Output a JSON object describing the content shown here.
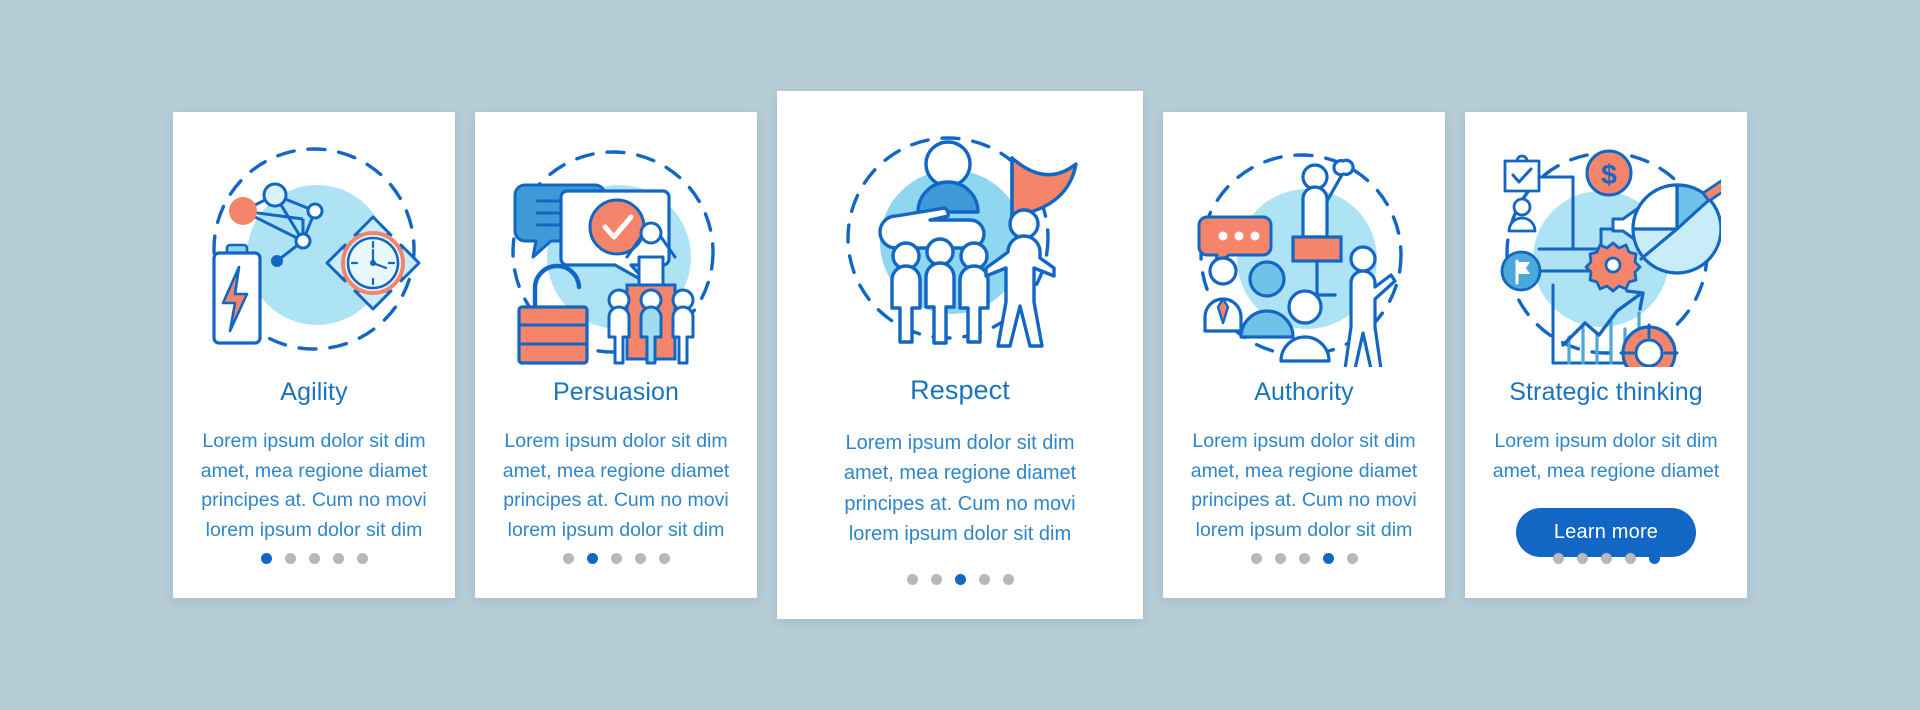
{
  "page": {
    "background_color": "#b6cdd8",
    "card_background": "#ffffff",
    "accent_blue": "#1266c4",
    "title_blue": "#1a74bb",
    "body_blue": "#2e86c8",
    "coral": "#f4846a",
    "light_blue": "#9fdcf0",
    "dot_inactive": "#b8b8b8"
  },
  "cards": [
    {
      "id": "agility",
      "illustration": "agility-network-battery-clock-arrows-icon",
      "title": "Agility",
      "body": "Lorem ipsum dolor sit dim amet, mea regione diamet principes at. Cum no movi lorem ipsum dolor sit dim",
      "cta": null,
      "dots": {
        "count": 5,
        "active_index": 0
      }
    },
    {
      "id": "persuasion",
      "illustration": "persuasion-speech-bubble-check-padlock-people-icon",
      "title": "Persuasion",
      "body": "Lorem ipsum dolor sit dim amet, mea regione diamet principes at. Cum no movi lorem ipsum dolor sit dim",
      "cta": null,
      "dots": {
        "count": 5,
        "active_index": 1
      }
    },
    {
      "id": "respect",
      "illustration": "respect-hand-people-flag-icon",
      "title": "Respect",
      "body": "Lorem ipsum dolor sit dim amet, mea regione diamet principes at. Cum no movi lorem ipsum dolor sit dim",
      "cta": null,
      "dots": {
        "count": 5,
        "active_index": 2
      }
    },
    {
      "id": "authority",
      "illustration": "authority-speaker-podium-audience-icon",
      "title": "Authority",
      "body": "Lorem ipsum dolor sit dim amet, mea regione diamet principes at. Cum no movi lorem ipsum dolor sit dim",
      "cta": null,
      "dots": {
        "count": 5,
        "active_index": 3
      }
    },
    {
      "id": "strategic-thinking",
      "illustration": "strategic-thinking-chart-piechart-target-dollar-icon",
      "title": "Strategic thinking",
      "body": "Lorem ipsum dolor sit dim amet, mea regione diamet",
      "cta": "Learn more",
      "dots": {
        "count": 5,
        "active_index": 4
      }
    }
  ]
}
